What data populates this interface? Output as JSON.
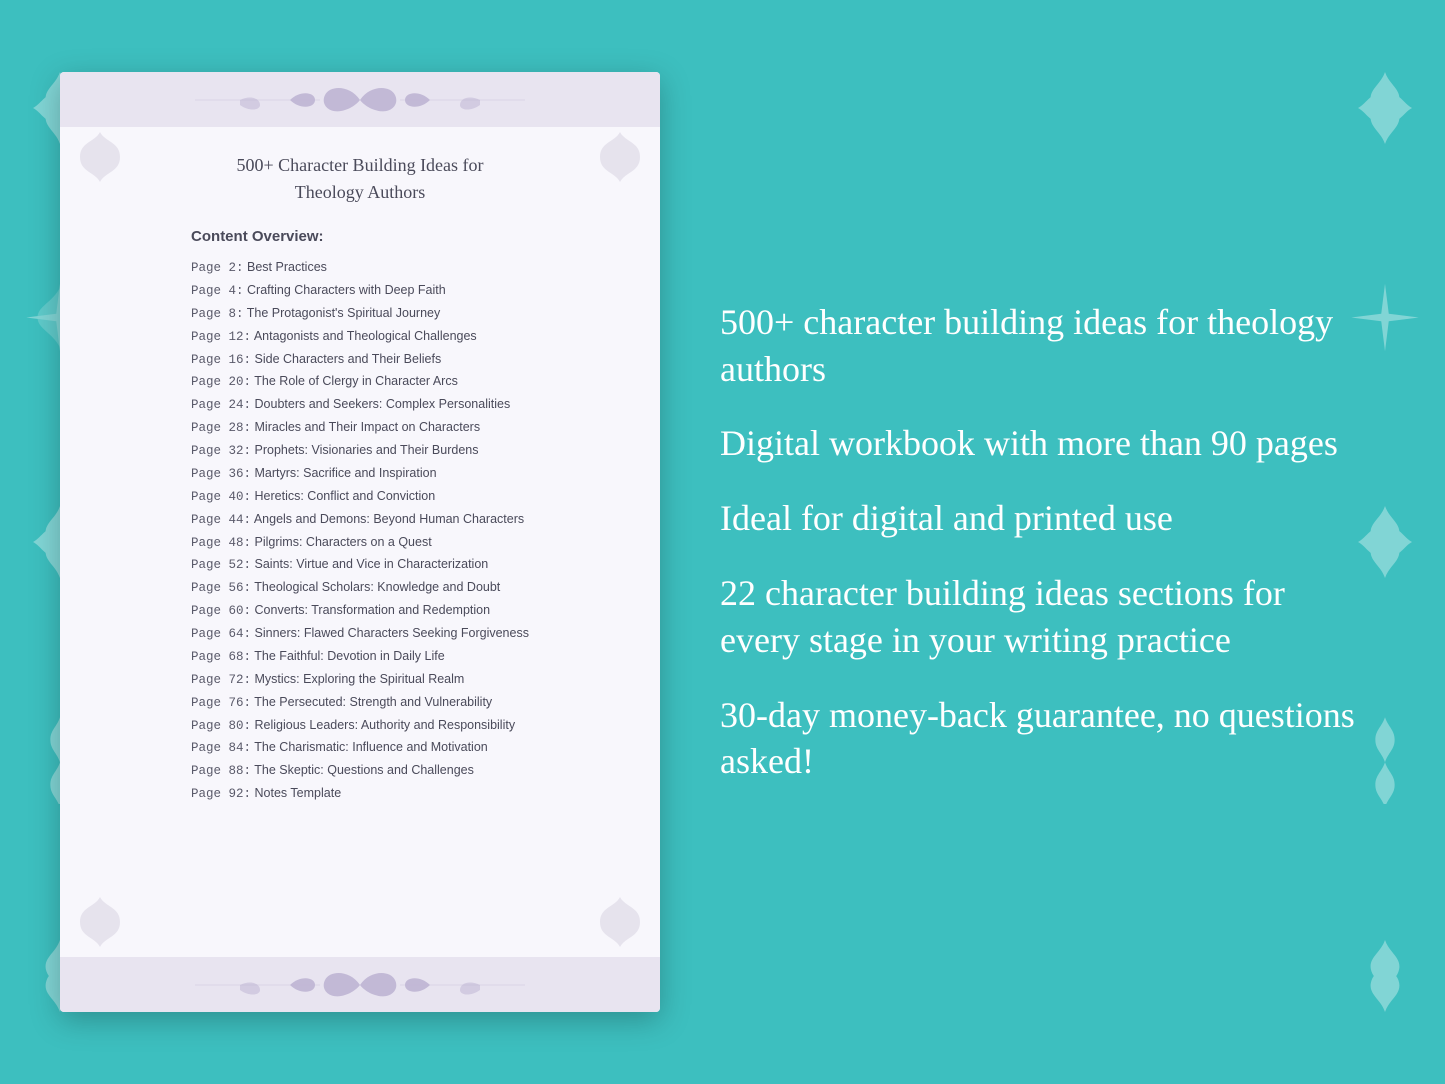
{
  "background_color": "#3dbfbf",
  "document": {
    "title_line1": "500+ Character Building Ideas for",
    "title_line2": "Theology Authors",
    "content_overview_label": "Content Overview:",
    "toc_items": [
      {
        "page": "Page  2:",
        "text": "Best Practices"
      },
      {
        "page": "Page  4:",
        "text": "Crafting Characters with Deep Faith"
      },
      {
        "page": "Page  8:",
        "text": "The Protagonist's Spiritual Journey"
      },
      {
        "page": "Page 12:",
        "text": "Antagonists and Theological Challenges"
      },
      {
        "page": "Page 16:",
        "text": "Side Characters and Their Beliefs"
      },
      {
        "page": "Page 20:",
        "text": "The Role of Clergy in Character Arcs"
      },
      {
        "page": "Page 24:",
        "text": "Doubters and Seekers: Complex Personalities"
      },
      {
        "page": "Page 28:",
        "text": "Miracles and Their Impact on Characters"
      },
      {
        "page": "Page 32:",
        "text": "Prophets: Visionaries and Their Burdens"
      },
      {
        "page": "Page 36:",
        "text": "Martyrs: Sacrifice and Inspiration"
      },
      {
        "page": "Page 40:",
        "text": "Heretics: Conflict and Conviction"
      },
      {
        "page": "Page 44:",
        "text": "Angels and Demons: Beyond Human Characters"
      },
      {
        "page": "Page 48:",
        "text": "Pilgrims: Characters on a Quest"
      },
      {
        "page": "Page 52:",
        "text": "Saints: Virtue and Vice in Characterization"
      },
      {
        "page": "Page 56:",
        "text": "Theological Scholars: Knowledge and Doubt"
      },
      {
        "page": "Page 60:",
        "text": "Converts: Transformation and Redemption"
      },
      {
        "page": "Page 64:",
        "text": "Sinners: Flawed Characters Seeking Forgiveness"
      },
      {
        "page": "Page 68:",
        "text": "The Faithful: Devotion in Daily Life"
      },
      {
        "page": "Page 72:",
        "text": "Mystics: Exploring the Spiritual Realm"
      },
      {
        "page": "Page 76:",
        "text": "The Persecuted: Strength and Vulnerability"
      },
      {
        "page": "Page 80:",
        "text": "Religious Leaders: Authority and Responsibility"
      },
      {
        "page": "Page 84:",
        "text": "The Charismatic: Influence and Motivation"
      },
      {
        "page": "Page 88:",
        "text": "The Skeptic: Questions and Challenges"
      },
      {
        "page": "Page 92:",
        "text": "Notes Template"
      }
    ]
  },
  "features": [
    "500+ character building ideas for theology authors",
    "Digital workbook with more than 90 pages",
    "Ideal for digital and printed use",
    "22 character building ideas sections for every stage in your writing practice",
    "30-day money-back guarantee, no questions asked!"
  ]
}
